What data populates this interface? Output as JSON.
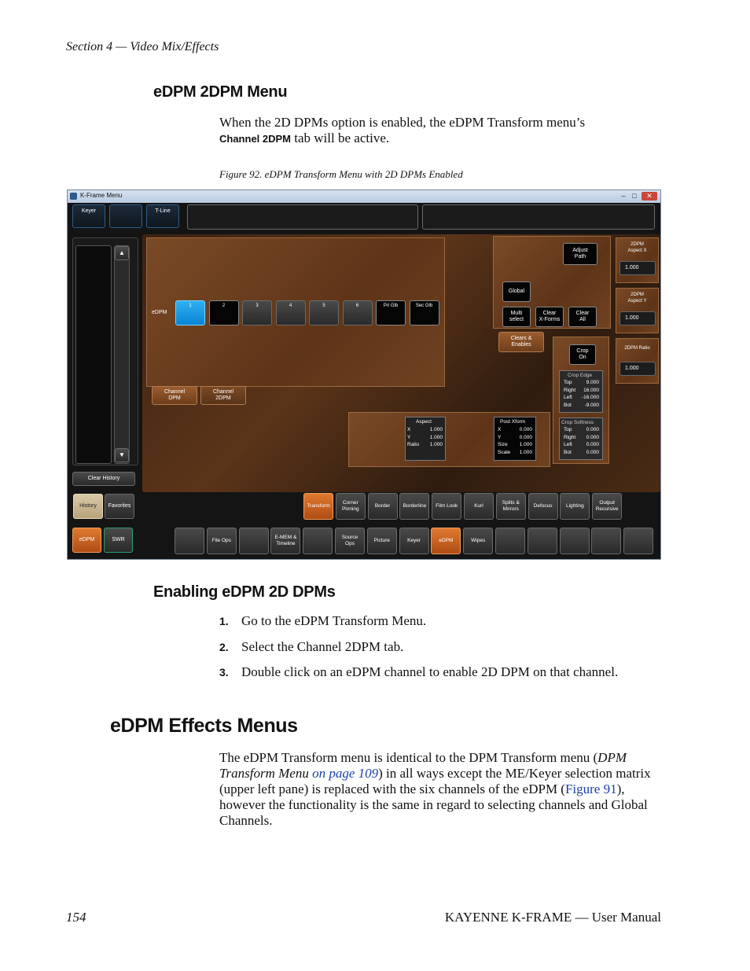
{
  "running_head": "Section 4 — Video Mix/Effects",
  "section1": {
    "heading": "eDPM 2DPM Menu",
    "p_before": "When the 2D DPMs option is enabled, the eDPM Transform menu’s",
    "p_ui": "Channel 2DPM",
    "p_after": " tab will be active."
  },
  "figure": {
    "caption": "Figure 92.  eDPM Transform Menu with 2D DPMs Enabled",
    "window_title": "K-Frame Menu",
    "top_buttons": [
      "Keyer",
      "",
      "T-Line"
    ],
    "clear_history": "Clear History",
    "history": "History",
    "favorites": "Favorites",
    "edpm_label": "eDPM",
    "channels": [
      "1",
      "2",
      "3",
      "4",
      "5",
      "6",
      "Pri Glb",
      "Sec Glb"
    ],
    "tab_channel_dpm": "Channel\nDPM",
    "tab_channel_2dpm": "Channel\n2DPM",
    "adjust_path": "Adjust\nPath",
    "global": "Global",
    "multi_select": "Multi\nselect",
    "clear_xforms": "Clear\nX-Forms",
    "clear_all": "Clear\nAll",
    "clears_enables": "Clears &\nEnables",
    "crop_on": "Crop\nOn",
    "crop_edge": {
      "title": "Crop Edge",
      "rows": [
        [
          "Top",
          "9.000"
        ],
        [
          "Right",
          "16.000"
        ],
        [
          "Left",
          "-16.000"
        ],
        [
          "Bot",
          "-9.000"
        ]
      ]
    },
    "crop_softness": {
      "title": "Crop Softness",
      "rows": [
        [
          "Top",
          "0.000"
        ],
        [
          "Right",
          "0.000"
        ],
        [
          "Left",
          "0.000"
        ],
        [
          "Bot",
          "0.000"
        ]
      ]
    },
    "aspect": {
      "title": "Aspect",
      "rows": [
        [
          "X",
          "1.000"
        ],
        [
          "Y",
          "1.000"
        ],
        [
          "Ratio",
          "1.000"
        ]
      ]
    },
    "post_xform": {
      "title": "Post Xform",
      "rows": [
        [
          "X",
          "0.000"
        ],
        [
          "Y",
          "0.000"
        ],
        [
          "Size",
          "1.000"
        ],
        [
          "Scale",
          "1.000"
        ]
      ]
    },
    "side_params": [
      {
        "label": "2DPM\nAspect X",
        "value": "1.000"
      },
      {
        "label": "2DPM\nAspect Y",
        "value": "1.000"
      },
      {
        "label": "2DPM Ratio",
        "value": "1.000"
      }
    ],
    "menu_tabs": [
      "Transform",
      "Corner\nPinning",
      "Border",
      "Borderline",
      "Film Look",
      "Kurl",
      "Splits &\nMirrors",
      "Defocus",
      "Lighting",
      "Output\nRecursive"
    ],
    "edpm_btn": "eDPM",
    "swr_btn": "SWR",
    "bottom_bar": [
      "",
      "File Ops",
      "",
      "E-MEM &\nTimeline",
      "",
      "Source\nOps",
      "Picture",
      "Keyer",
      "eDPM",
      "Wipes",
      "",
      "",
      "",
      "",
      ""
    ]
  },
  "section2": {
    "heading": "Enabling eDPM 2D DPMs",
    "steps": [
      {
        "n": "1.",
        "text": "Go to the eDPM Transform Menu."
      },
      {
        "n": "2.",
        "text": "Select the Channel 2DPM tab."
      },
      {
        "n": "3.",
        "text": "Double click on an eDPM channel to enable 2D DPM on that channel."
      }
    ]
  },
  "section3": {
    "heading": "eDPM Effects Menus",
    "p1": "The eDPM Transform menu is identical to the DPM Transform menu (",
    "p1_ref_italic": "DPM Transform Menu",
    "p1_ref_link": "on page 109",
    "p1_b": ") in all ways except the ME/Keyer selection matrix (upper left pane) is replaced with the six channels of the eDPM (",
    "p1_fig_link": "Figure 91",
    "p1_c": "), however the functionality is the same in regard to selecting channels and Global Channels."
  },
  "footer": {
    "page_number": "154",
    "manual": "KAYENNE K-FRAME  —  User Manual"
  }
}
